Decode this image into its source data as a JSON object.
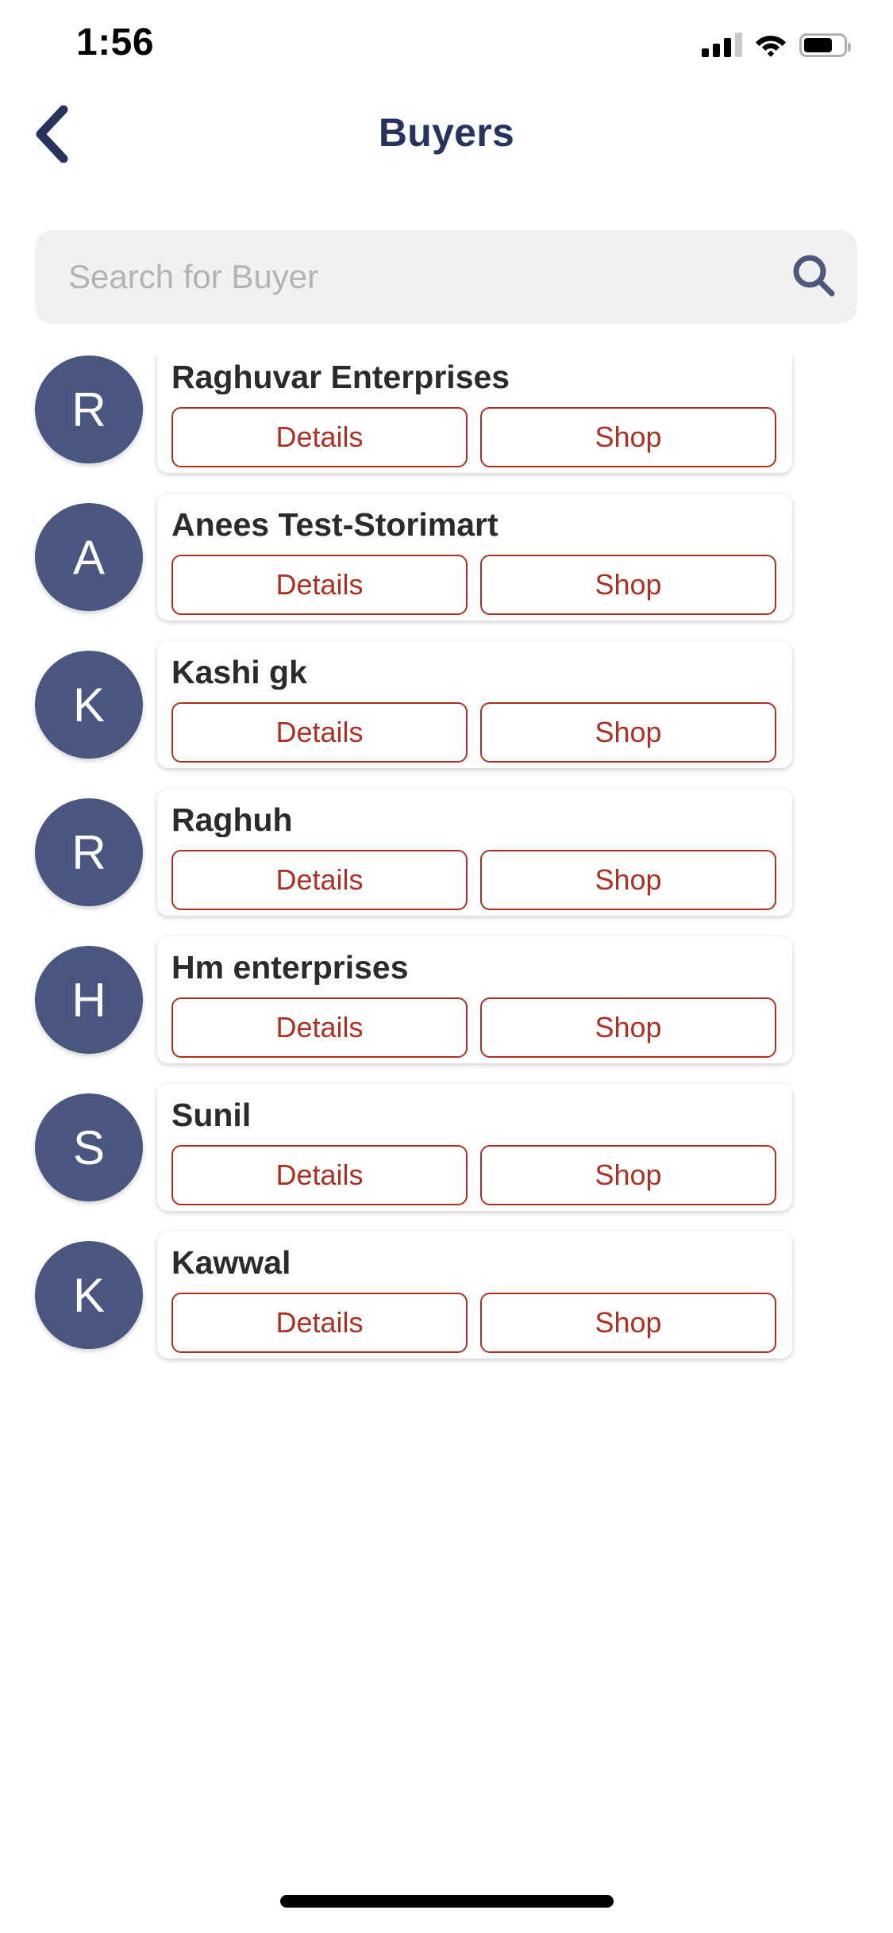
{
  "status_bar": {
    "time": "1:56",
    "signal_icon": "cellular-signal-icon",
    "signal_bars_filled": 3,
    "signal_bars_total": 4,
    "wifi_icon": "wifi-icon",
    "battery_icon": "battery-icon",
    "battery_level_percent": 72
  },
  "nav": {
    "back_icon": "chevron-left-icon",
    "title": "Buyers"
  },
  "search": {
    "placeholder": "Search for Buyer",
    "value": "",
    "icon": "search-icon"
  },
  "colors": {
    "title_navy": "#27335c",
    "avatar_slate": "#4a5580",
    "action_red": "#a93226",
    "search_background": "#f1f1f1",
    "card_background": "#ffffff",
    "page_background": "#ffffff",
    "name_text": "#2b2b2b",
    "placeholder_gray": "#b3b3b3"
  },
  "actions": {
    "details_label": "Details",
    "shop_label": "Shop"
  },
  "buyers": [
    {
      "initial": "R",
      "name": "Raghuvar Enterprises"
    },
    {
      "initial": "A",
      "name": "Anees Test-Storimart"
    },
    {
      "initial": "K",
      "name": "Kashi gk"
    },
    {
      "initial": "R",
      "name": "Raghuh"
    },
    {
      "initial": "H",
      "name": "Hm enterprises"
    },
    {
      "initial": "S",
      "name": "Sunil"
    },
    {
      "initial": "K",
      "name": "Kawwal"
    }
  ]
}
